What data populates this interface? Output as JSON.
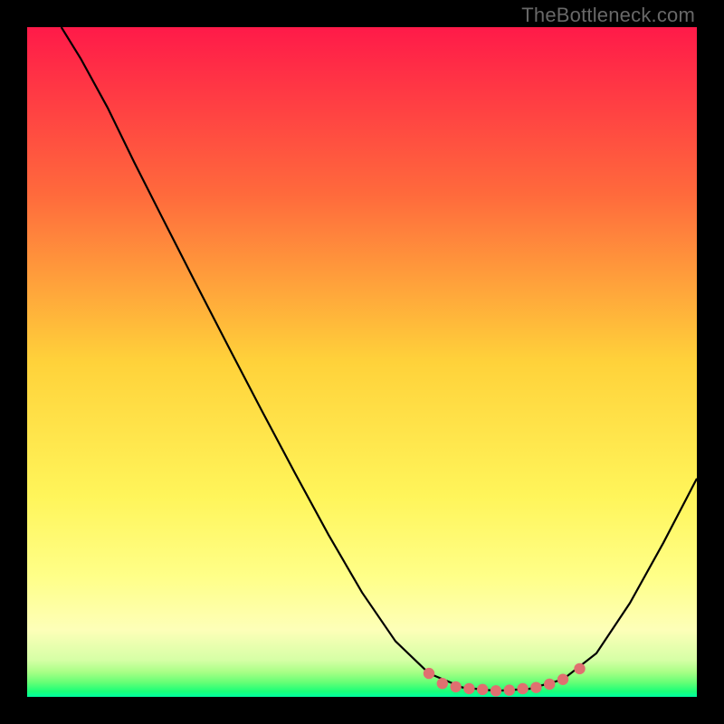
{
  "watermark": "TheBottleneck.com",
  "colors": {
    "background": "#000000",
    "curve_stroke": "#000000",
    "marker_fill": "#e07070",
    "gradient_stops": [
      {
        "offset": 0,
        "color": "#ff1a49"
      },
      {
        "offset": 0.25,
        "color": "#ff6a3c"
      },
      {
        "offset": 0.5,
        "color": "#ffd23a"
      },
      {
        "offset": 0.7,
        "color": "#fff55a"
      },
      {
        "offset": 0.82,
        "color": "#ffff88"
      },
      {
        "offset": 0.9,
        "color": "#fdffb8"
      },
      {
        "offset": 0.945,
        "color": "#d6ffa6"
      },
      {
        "offset": 0.963,
        "color": "#a8ff86"
      },
      {
        "offset": 0.978,
        "color": "#68ff76"
      },
      {
        "offset": 0.992,
        "color": "#1aff78"
      },
      {
        "offset": 1.0,
        "color": "#00ffa2"
      }
    ]
  },
  "chart_data": {
    "type": "line",
    "title": "",
    "xlabel": "",
    "ylabel": "",
    "xlim": [
      0,
      100
    ],
    "ylim": [
      0,
      100
    ],
    "grid": false,
    "curve": [
      {
        "x": 5.1,
        "y": 100
      },
      {
        "x": 8.0,
        "y": 95.3
      },
      {
        "x": 12.0,
        "y": 88.0
      },
      {
        "x": 16.0,
        "y": 79.8
      },
      {
        "x": 20.0,
        "y": 71.9
      },
      {
        "x": 25.0,
        "y": 62.1
      },
      {
        "x": 30.0,
        "y": 52.4
      },
      {
        "x": 35.0,
        "y": 42.8
      },
      {
        "x": 40.0,
        "y": 33.4
      },
      {
        "x": 45.0,
        "y": 24.2
      },
      {
        "x": 50.0,
        "y": 15.6
      },
      {
        "x": 55.0,
        "y": 8.3
      },
      {
        "x": 60.0,
        "y": 3.5
      },
      {
        "x": 65.0,
        "y": 1.4
      },
      {
        "x": 70.0,
        "y": 0.9
      },
      {
        "x": 75.0,
        "y": 1.2
      },
      {
        "x": 80.0,
        "y": 2.6
      },
      {
        "x": 85.0,
        "y": 6.5
      },
      {
        "x": 90.0,
        "y": 14.0
      },
      {
        "x": 95.0,
        "y": 23.0
      },
      {
        "x": 100.0,
        "y": 32.6
      }
    ],
    "markers": [
      {
        "x": 60.0,
        "y": 3.5
      },
      {
        "x": 62.0,
        "y": 2.0
      },
      {
        "x": 64.0,
        "y": 1.5
      },
      {
        "x": 66.0,
        "y": 1.23
      },
      {
        "x": 68.0,
        "y": 1.1
      },
      {
        "x": 70.0,
        "y": 0.9
      },
      {
        "x": 72.0,
        "y": 1.0
      },
      {
        "x": 74.0,
        "y": 1.22
      },
      {
        "x": 76.0,
        "y": 1.4
      },
      {
        "x": 78.0,
        "y": 1.9
      },
      {
        "x": 80.0,
        "y": 2.6
      },
      {
        "x": 82.5,
        "y": 4.2
      }
    ]
  }
}
